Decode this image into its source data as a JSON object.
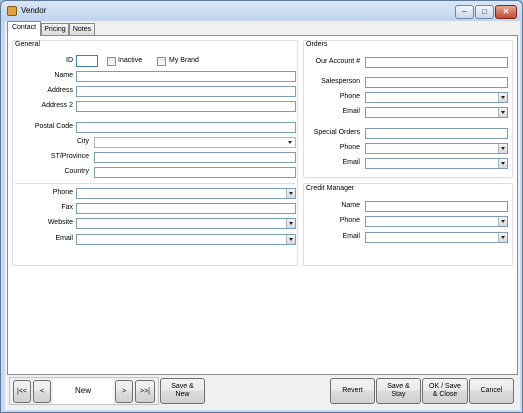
{
  "window": {
    "title": "Vendor",
    "minimize": "–",
    "maximize": "□",
    "close": "✕"
  },
  "tabs": [
    "Contact",
    "Pricing",
    "Notes"
  ],
  "general": {
    "title": "General",
    "id_label": "ID",
    "id_value": "",
    "inactive_label": "Inactive",
    "my_brand_label": "My Brand",
    "name_label": "Name",
    "address_label": "Address",
    "address2_label": "Address 2",
    "postal_label": "Postal Code",
    "city_label": "City",
    "st_label": "ST/Province",
    "country_label": "Country",
    "phone_label": "Phone",
    "fax_label": "Fax",
    "website_label": "Website",
    "email_label": "Email"
  },
  "orders": {
    "title": "Orders",
    "account_label": "Our Account #",
    "salesperson_label": "Salesperson",
    "phone_label": "Phone",
    "email_label": "Email",
    "special_label": "Special Orders",
    "special_phone_label": "Phone",
    "special_email_label": "Email"
  },
  "credit": {
    "title": "Credit Manager",
    "name_label": "Name",
    "phone_label": "Phone",
    "email_label": "Email"
  },
  "footer": {
    "first": "|<<",
    "prev": "<",
    "record": "New",
    "next": ">",
    "last": ">>|",
    "save_new": "Save &\nNew",
    "revert": "Revert",
    "save_stay": "Save &\nStay",
    "ok_save_close": "OK / Save\n& Close",
    "cancel": "Cancel"
  }
}
